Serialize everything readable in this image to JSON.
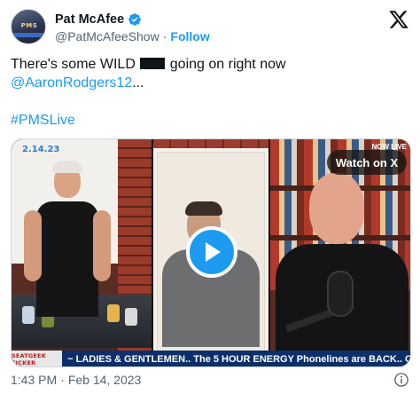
{
  "author": {
    "display_name": "Pat McAfee",
    "handle": "@PatMcAfeeShow",
    "separator": "·",
    "follow_label": "Follow",
    "avatar_text": "PMS",
    "verified_icon": "verified-badge-icon"
  },
  "brand_icon": "x-logo-icon",
  "tweet": {
    "text_before_redaction": "There's some WILD",
    "text_after_redaction": "going on right now",
    "mention": "@AaronRodgers12",
    "ellipsis": "...",
    "hashtag": "#PMSLive"
  },
  "media": {
    "date_overlay": "2.14.23",
    "corner_overlay": "NOW LIVE",
    "watch_label": "Watch on X",
    "play_icon": "play-icon",
    "ticker_logo": "SEATGEEK TICKER",
    "ticker_text": "~ LADIES & GENTLEMEN.. The 5 HOUR ENERGY Phonelines are BACK.. C"
  },
  "meta": {
    "time": "1:43 PM",
    "separator": "·",
    "date": "Feb 14, 2023",
    "info_icon": "info-icon"
  },
  "colors": {
    "accent": "#1d9bf0",
    "text_primary": "#0f1419",
    "text_secondary": "#536471"
  }
}
